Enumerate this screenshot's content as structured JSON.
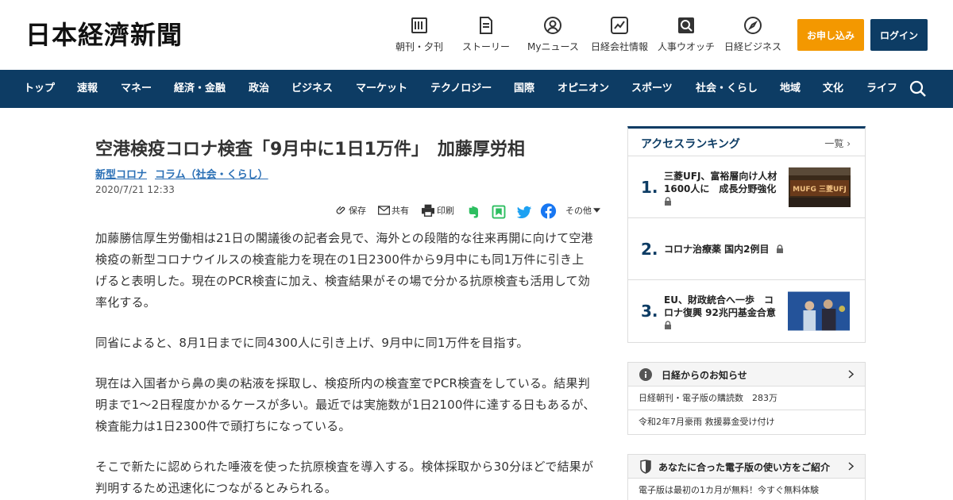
{
  "header": {
    "logo": "日本経濟新聞",
    "nav_icons": [
      {
        "label": "朝刊・夕刊",
        "icon": "newspaper-icon"
      },
      {
        "label": "ストーリー",
        "icon": "document-icon"
      },
      {
        "label": "Myニュース",
        "icon": "person-icon"
      },
      {
        "label": "日経会社情報",
        "icon": "chart-icon"
      },
      {
        "label": "人事ウオッチ",
        "icon": "magnifier-icon"
      },
      {
        "label": "日経ビジネス",
        "icon": "compass-icon"
      }
    ],
    "apply_label": "お申し込み",
    "login_label": "ログイン"
  },
  "nav": {
    "items": [
      "トップ",
      "速報",
      "マネー",
      "経済・金融",
      "政治",
      "ビジネス",
      "マーケット",
      "テクノロジー",
      "国際",
      "オピニオン",
      "スポーツ",
      "社会・くらし",
      "地域",
      "文化",
      "ライフ"
    ]
  },
  "article": {
    "title": "空港検疫コロナ検査「9月中に1日1万件」　加藤厚労相",
    "tags": [
      "新型コロナ",
      "コラム（社会・くらし）"
    ],
    "date": "2020/7/21 12:33",
    "share": {
      "save": "保存",
      "share": "共有",
      "print": "印刷",
      "more": "その他"
    },
    "paragraphs": [
      "加藤勝信厚生労働相は21日の閣議後の記者会見で、海外との段階的な往来再開に向けて空港検疫の新型コロナウイルスの検査能力を現在の1日2300件から9月中にも同1万件に引き上げると表明した。現在のPCR検査に加え、検査結果がその場で分かる抗原検査も活用して効率化する。",
      "同省によると、8月1日までに同4300人に引き上げ、9月中に同1万件を目指す。",
      "現在は入国者から鼻の奥の粘液を採取し、検疫所内の検査室でPCR検査をしている。結果判明まで1～2日程度かかるケースが多い。最近では実施数が1日2100件に達する日もあるが、検査能力は1日2300件で頭打ちになっている。",
      "そこで新たに認められた唾液を使った抗原検査を導入する。検体採取から30分ほどで結果が判明するため迅速化につながるとみられる。"
    ]
  },
  "ranking": {
    "title": "アクセスランキング",
    "more": "一覧",
    "items": [
      {
        "rank": "1.",
        "text": "三菱UFJ、富裕層向け人材1600人に　成長分野強化",
        "thumb_text": "MUFG 三菱UFJ"
      },
      {
        "rank": "2.",
        "text": "コロナ治療薬 国内2例目"
      },
      {
        "rank": "3.",
        "text": "EU、財政統合へ一歩　コロナ復興 92兆円基金合意"
      }
    ]
  },
  "notices": {
    "title": "日経からのお知らせ",
    "items": [
      "日経朝刊・電子版の購読数　283万",
      "令和2年7月豪雨 救援募金受け付け"
    ]
  },
  "guide": {
    "title": "あなたに合った電子版の使い方をご紹介",
    "text": "電子版は最初の1カ月が無料！今すぐ無料体験"
  }
}
